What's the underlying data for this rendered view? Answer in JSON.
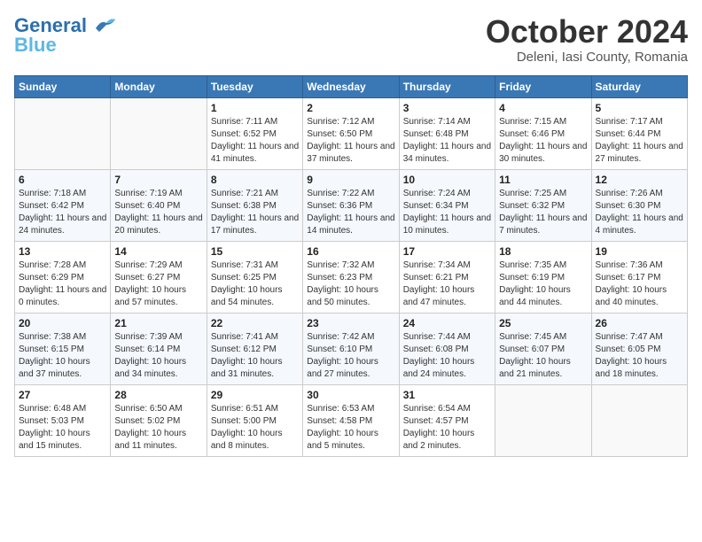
{
  "header": {
    "logo_line1": "General",
    "logo_line2": "Blue",
    "month_title": "October 2024",
    "location": "Deleni, Iasi County, Romania"
  },
  "weekdays": [
    "Sunday",
    "Monday",
    "Tuesday",
    "Wednesday",
    "Thursday",
    "Friday",
    "Saturday"
  ],
  "weeks": [
    [
      {
        "day": "",
        "detail": ""
      },
      {
        "day": "",
        "detail": ""
      },
      {
        "day": "1",
        "detail": "Sunrise: 7:11 AM\nSunset: 6:52 PM\nDaylight: 11 hours and 41 minutes."
      },
      {
        "day": "2",
        "detail": "Sunrise: 7:12 AM\nSunset: 6:50 PM\nDaylight: 11 hours and 37 minutes."
      },
      {
        "day": "3",
        "detail": "Sunrise: 7:14 AM\nSunset: 6:48 PM\nDaylight: 11 hours and 34 minutes."
      },
      {
        "day": "4",
        "detail": "Sunrise: 7:15 AM\nSunset: 6:46 PM\nDaylight: 11 hours and 30 minutes."
      },
      {
        "day": "5",
        "detail": "Sunrise: 7:17 AM\nSunset: 6:44 PM\nDaylight: 11 hours and 27 minutes."
      }
    ],
    [
      {
        "day": "6",
        "detail": "Sunrise: 7:18 AM\nSunset: 6:42 PM\nDaylight: 11 hours and 24 minutes."
      },
      {
        "day": "7",
        "detail": "Sunrise: 7:19 AM\nSunset: 6:40 PM\nDaylight: 11 hours and 20 minutes."
      },
      {
        "day": "8",
        "detail": "Sunrise: 7:21 AM\nSunset: 6:38 PM\nDaylight: 11 hours and 17 minutes."
      },
      {
        "day": "9",
        "detail": "Sunrise: 7:22 AM\nSunset: 6:36 PM\nDaylight: 11 hours and 14 minutes."
      },
      {
        "day": "10",
        "detail": "Sunrise: 7:24 AM\nSunset: 6:34 PM\nDaylight: 11 hours and 10 minutes."
      },
      {
        "day": "11",
        "detail": "Sunrise: 7:25 AM\nSunset: 6:32 PM\nDaylight: 11 hours and 7 minutes."
      },
      {
        "day": "12",
        "detail": "Sunrise: 7:26 AM\nSunset: 6:30 PM\nDaylight: 11 hours and 4 minutes."
      }
    ],
    [
      {
        "day": "13",
        "detail": "Sunrise: 7:28 AM\nSunset: 6:29 PM\nDaylight: 11 hours and 0 minutes."
      },
      {
        "day": "14",
        "detail": "Sunrise: 7:29 AM\nSunset: 6:27 PM\nDaylight: 10 hours and 57 minutes."
      },
      {
        "day": "15",
        "detail": "Sunrise: 7:31 AM\nSunset: 6:25 PM\nDaylight: 10 hours and 54 minutes."
      },
      {
        "day": "16",
        "detail": "Sunrise: 7:32 AM\nSunset: 6:23 PM\nDaylight: 10 hours and 50 minutes."
      },
      {
        "day": "17",
        "detail": "Sunrise: 7:34 AM\nSunset: 6:21 PM\nDaylight: 10 hours and 47 minutes."
      },
      {
        "day": "18",
        "detail": "Sunrise: 7:35 AM\nSunset: 6:19 PM\nDaylight: 10 hours and 44 minutes."
      },
      {
        "day": "19",
        "detail": "Sunrise: 7:36 AM\nSunset: 6:17 PM\nDaylight: 10 hours and 40 minutes."
      }
    ],
    [
      {
        "day": "20",
        "detail": "Sunrise: 7:38 AM\nSunset: 6:15 PM\nDaylight: 10 hours and 37 minutes."
      },
      {
        "day": "21",
        "detail": "Sunrise: 7:39 AM\nSunset: 6:14 PM\nDaylight: 10 hours and 34 minutes."
      },
      {
        "day": "22",
        "detail": "Sunrise: 7:41 AM\nSunset: 6:12 PM\nDaylight: 10 hours and 31 minutes."
      },
      {
        "day": "23",
        "detail": "Sunrise: 7:42 AM\nSunset: 6:10 PM\nDaylight: 10 hours and 27 minutes."
      },
      {
        "day": "24",
        "detail": "Sunrise: 7:44 AM\nSunset: 6:08 PM\nDaylight: 10 hours and 24 minutes."
      },
      {
        "day": "25",
        "detail": "Sunrise: 7:45 AM\nSunset: 6:07 PM\nDaylight: 10 hours and 21 minutes."
      },
      {
        "day": "26",
        "detail": "Sunrise: 7:47 AM\nSunset: 6:05 PM\nDaylight: 10 hours and 18 minutes."
      }
    ],
    [
      {
        "day": "27",
        "detail": "Sunrise: 6:48 AM\nSunset: 5:03 PM\nDaylight: 10 hours and 15 minutes."
      },
      {
        "day": "28",
        "detail": "Sunrise: 6:50 AM\nSunset: 5:02 PM\nDaylight: 10 hours and 11 minutes."
      },
      {
        "day": "29",
        "detail": "Sunrise: 6:51 AM\nSunset: 5:00 PM\nDaylight: 10 hours and 8 minutes."
      },
      {
        "day": "30",
        "detail": "Sunrise: 6:53 AM\nSunset: 4:58 PM\nDaylight: 10 hours and 5 minutes."
      },
      {
        "day": "31",
        "detail": "Sunrise: 6:54 AM\nSunset: 4:57 PM\nDaylight: 10 hours and 2 minutes."
      },
      {
        "day": "",
        "detail": ""
      },
      {
        "day": "",
        "detail": ""
      }
    ]
  ]
}
